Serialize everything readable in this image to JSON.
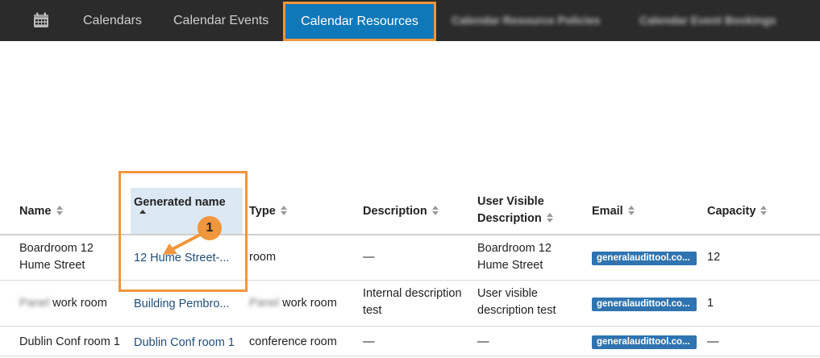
{
  "nav": {
    "icon": "calendar-icon",
    "items": [
      {
        "label": "Calendars"
      },
      {
        "label": "Calendar Events"
      },
      {
        "label": "Calendar Resources",
        "active": true
      },
      {
        "label": "Calendar Resource Policies",
        "blurred": true
      },
      {
        "label": "Calendar Event Bookings",
        "blurred": true
      }
    ]
  },
  "table": {
    "columns": [
      {
        "label": "Name"
      },
      {
        "label": "Generated name",
        "sorted": "asc"
      },
      {
        "label": "Type"
      },
      {
        "label": "Description"
      },
      {
        "label_line1": "User Visible",
        "label_line2": "Description"
      },
      {
        "label": "Email"
      },
      {
        "label": "Capacity"
      }
    ],
    "rows": [
      {
        "name_line1": "Boardroom 12",
        "name_line2": "Hume Street",
        "generated": "12 Hume Street-...",
        "type": "room",
        "description": "—",
        "user_desc_line1": "Boardroom 12",
        "user_desc_line2": "Hume Street",
        "email": "generalaudittool.co...",
        "capacity": "12"
      },
      {
        "name_blur": "Panel",
        "name_rest": " work room",
        "generated": "Building Pembro...",
        "type_blur": "Panel",
        "type_rest": " work room",
        "description_line1": "Internal description",
        "description_line2": "test",
        "user_desc_line1": "User visible",
        "user_desc_line2": "description test",
        "email": "generalaudittool.co...",
        "capacity": "1"
      },
      {
        "name": "Dublin Conf room 1",
        "generated": "Dublin Conf room 1",
        "type": "conference room",
        "description": "—",
        "user_desc": "—",
        "email": "generalaudittool.co...",
        "capacity": "—"
      }
    ]
  },
  "annotation": {
    "number": "1",
    "color": "#f0963c"
  },
  "colors": {
    "nav_bg": "#2b2b2b",
    "active_tab": "#0f78b8",
    "link": "#1f4e79",
    "badge": "#2f74b0",
    "highlight": "#dce8f3"
  }
}
